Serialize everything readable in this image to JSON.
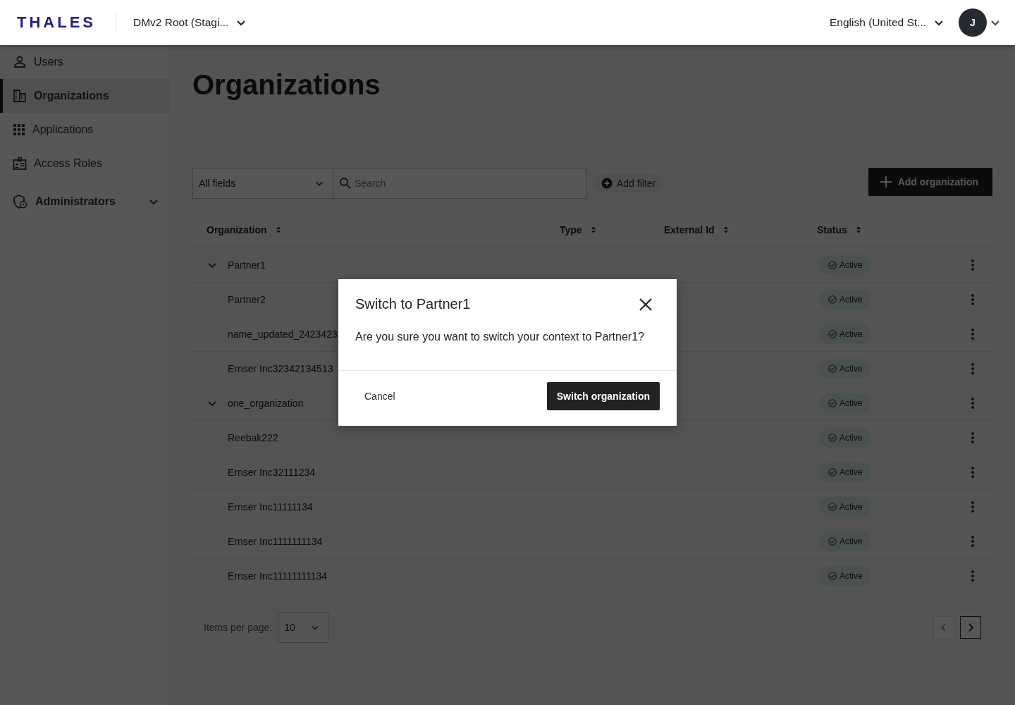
{
  "header": {
    "logo": "THALES",
    "context": "DMv2 Root (Stagi...",
    "language": "English (United St...",
    "avatar": "J"
  },
  "sidebar": {
    "items": [
      {
        "label": "Users",
        "kind": "user",
        "selected": false
      },
      {
        "label": "Organizations",
        "kind": "building",
        "selected": true
      },
      {
        "label": "Applications",
        "kind": "grid",
        "selected": false
      },
      {
        "label": "Access Roles",
        "kind": "badge",
        "selected": false
      },
      {
        "label": "Administrators",
        "kind": "shield",
        "selected": false,
        "expanded": false
      }
    ]
  },
  "page": {
    "title": "Organizations"
  },
  "filters": {
    "field": "All fields",
    "search_placeholder": "Search",
    "add_filter": "Add filter",
    "add_button": "Add organization"
  },
  "table": {
    "columns": [
      "Organization",
      "Type",
      "External Id",
      "Status"
    ],
    "rows": [
      {
        "name": "Partner1",
        "status": "Active",
        "expanded": true,
        "children": [
          {
            "name": "Partner2",
            "status": "Active"
          },
          {
            "name": "name_updated_2423423",
            "status": "Active"
          },
          {
            "name": "Ernser Inc32342134513",
            "status": "Active"
          }
        ]
      },
      {
        "name": "one_organization",
        "status": "Active",
        "expanded": true,
        "children": [
          {
            "name": "Reebak222",
            "status": "Active"
          },
          {
            "name": "Ernser Inc32111234",
            "status": "Active"
          },
          {
            "name": "Ernser Inc11111134",
            "status": "Active"
          },
          {
            "name": "Ernser Inc1111111134",
            "status": "Active"
          },
          {
            "name": "Ernser Inc11111111134",
            "status": "Active"
          }
        ]
      }
    ]
  },
  "pagination": {
    "label": "Items per page:",
    "page_size": "10",
    "prev_disabled": true,
    "next_disabled": false
  },
  "dialog": {
    "title": "Switch to Partner1",
    "message": "Are you sure you want to switch your context to Partner1?",
    "cancel": "Cancel",
    "confirm": "Switch organization"
  }
}
